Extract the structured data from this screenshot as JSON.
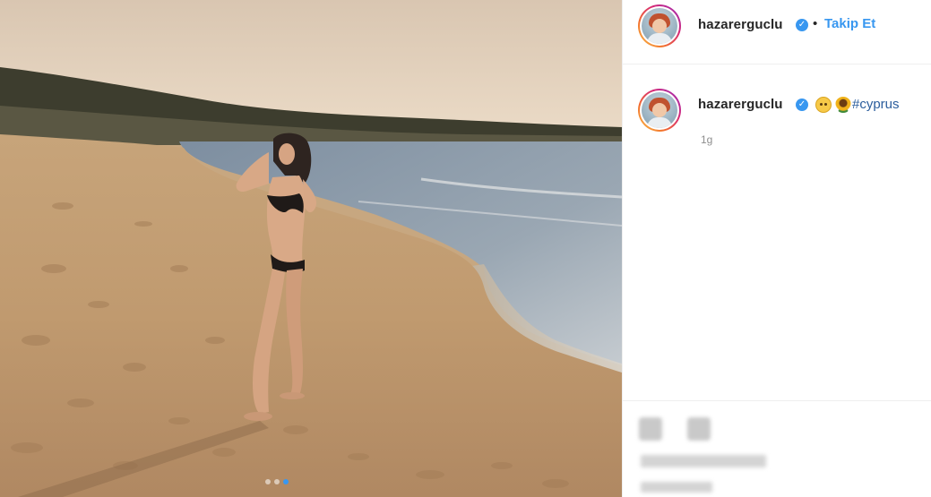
{
  "post": {
    "author": {
      "username": "hazarerguclu",
      "verified_symbol": "✓",
      "avatar_icon": "profile-avatar"
    },
    "header": {
      "separator": "•",
      "follow_label": "Takip Et"
    },
    "caption": {
      "emoji": [
        "pensive-face-emoji",
        "sunflower-emoji"
      ],
      "hashtag": "#cyprus"
    },
    "time_ago": "1g",
    "carousel": {
      "count": 3,
      "active_index": 2
    },
    "photo_description_icon": "beach-photo"
  },
  "colors": {
    "follow_blue": "#3897f0",
    "hashtag_blue": "#2b5d9c",
    "verified_blue": "#3897f0",
    "muted_text": "#8e8e8e"
  }
}
